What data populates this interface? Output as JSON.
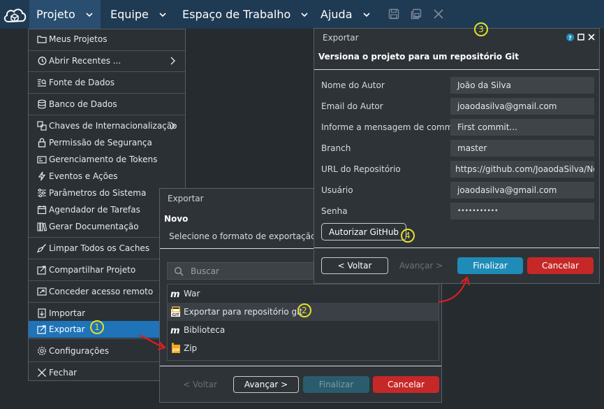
{
  "menubar": {
    "items": [
      "Projeto",
      "Equipe",
      "Espaço de Trabalho",
      "Ajuda"
    ],
    "icons": [
      "save-icon",
      "save-all-icon",
      "close-icon"
    ]
  },
  "project_menu": {
    "items": [
      {
        "label": "Meus Projetos",
        "icon": "folder-icon"
      },
      {
        "label": "Abrir Recentes ...",
        "icon": "history-icon",
        "submenu": true
      },
      {
        "label": "Fonte de Dados",
        "icon": "datasource-icon"
      },
      {
        "label": "Banco de Dados",
        "icon": "database-icon"
      },
      {
        "label": "Chaves de Internacionalização",
        "icon": "translate-icon",
        "submenu": true
      },
      {
        "label": "Permissão de Segurança",
        "icon": "lock-icon"
      },
      {
        "label": "Gerenciamento de Tokens",
        "icon": "token-icon"
      },
      {
        "label": "Eventos e Ações",
        "icon": "bolt-icon"
      },
      {
        "label": "Parâmetros do Sistema",
        "icon": "sliders-icon"
      },
      {
        "label": "Agendador de Tarefas",
        "icon": "calendar-icon"
      },
      {
        "label": "Gerar Documentação",
        "icon": "books-icon"
      },
      {
        "label": "Limpar Todos os Caches",
        "icon": "broom-icon"
      },
      {
        "label": "Compartilhar Projeto",
        "icon": "share-icon"
      },
      {
        "label": "Conceder acesso remoto",
        "icon": "remote-icon"
      },
      {
        "label": "Importar",
        "icon": "import-icon"
      },
      {
        "label": "Exportar",
        "icon": "export-icon",
        "selected": true
      },
      {
        "label": "Configurações",
        "icon": "gear-icon"
      },
      {
        "label": "Fechar",
        "icon": "close-icon"
      }
    ]
  },
  "export_dialog": {
    "title": "Exportar",
    "heading": "Novo",
    "instruction": "Selecione o formato de exportação",
    "search_placeholder": "Buscar",
    "formats": [
      {
        "label": "War",
        "icon": "mobile-m-icon"
      },
      {
        "label": "Exportar para repositório git",
        "icon": "git-icon",
        "highlighted": true
      },
      {
        "label": "Biblioteca",
        "icon": "mobile-m-icon"
      },
      {
        "label": "Zip",
        "icon": "zip-icon"
      }
    ],
    "buttons": {
      "back": "< Voltar",
      "next": "Avançar >",
      "finish": "Finalizar",
      "cancel": "Cancelar"
    }
  },
  "git_dialog": {
    "title": "Exportar",
    "heading": "Versiona o projeto para um repositório Git",
    "fields": [
      {
        "label": "Nome do Autor",
        "value": "João da Silva"
      },
      {
        "label": "Email do Autor",
        "value": "joaodasilva@gmail.com"
      },
      {
        "label": "Informe a mensagem de commit",
        "value": "First commit..."
      },
      {
        "label": "Branch",
        "value": "master"
      },
      {
        "label": "URL do Repositório",
        "value": "https://github.com/JoaodaSilva/No"
      },
      {
        "label": "Usuário",
        "value": "joaodasilva@gmail.com"
      },
      {
        "label": "Senha",
        "value": "•••••••••••"
      }
    ],
    "authorize_button": "Autorizar GitHub",
    "buttons": {
      "back": "< Voltar",
      "next": "Avançar >",
      "finish": "Finalizar",
      "cancel": "Cancelar"
    },
    "window_controls": [
      "help-icon",
      "maximize-icon",
      "close-icon"
    ]
  },
  "step_badges": [
    "1",
    "2",
    "3",
    "4"
  ],
  "colors": {
    "accent": "#1f8cb8",
    "selected": "#1f73b7",
    "danger": "#c62828",
    "badge": "#e5e02a",
    "menubar": "#1f3a53"
  }
}
